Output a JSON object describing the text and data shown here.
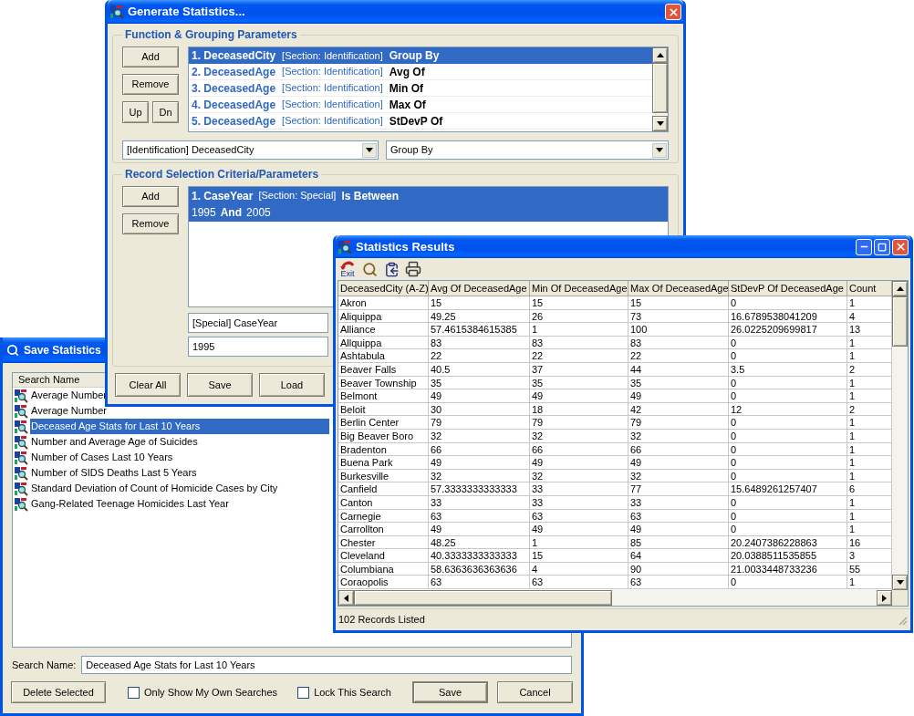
{
  "save_window": {
    "title": "Save Statistics",
    "column": "Search Name",
    "items": [
      {
        "name": "Average Number",
        "selected": false
      },
      {
        "name": "Average Number",
        "selected": false
      },
      {
        "name": "Deceased Age Stats for Last 10 Years",
        "selected": true
      },
      {
        "name": "Number and Average Age of Suicides",
        "selected": false
      },
      {
        "name": "Number of Cases Last 10 Years",
        "selected": false
      },
      {
        "name": "Number of SIDS Deaths Last 5 Years",
        "selected": false
      },
      {
        "name": "Standard Deviation of Count of Homicide Cases by City",
        "selected": false
      },
      {
        "name": "Gang-Related Teenage Homicides Last Year",
        "selected": false
      }
    ],
    "search_name_label": "Search Name:",
    "search_name_value": "Deceased Age Stats for Last 10 Years",
    "delete_button": "Delete Selected",
    "checkboxes": [
      {
        "label": "Only Show My Own Searches",
        "checked": false
      },
      {
        "label": "Lock This Search",
        "checked": false
      }
    ],
    "buttons": [
      "Save",
      "Cancel"
    ]
  },
  "generate_window": {
    "title": "Generate Statistics...",
    "function_group": {
      "title": "Function & Grouping Parameters",
      "buttons": [
        "Add",
        "Remove",
        "Up",
        "Dn"
      ],
      "items": [
        {
          "number": "1.",
          "field": "DeceasedCity",
          "section": "[Section: Identification]",
          "function": "Group By",
          "selected": true
        },
        {
          "number": "2.",
          "field": "DeceasedAge",
          "section": "[Section: Identification]",
          "function": "Avg Of",
          "selected": false
        },
        {
          "number": "3.",
          "field": "DeceasedAge",
          "section": "[Section: Identification]",
          "function": "Min Of",
          "selected": false
        },
        {
          "number": "4.",
          "field": "DeceasedAge",
          "section": "[Section: Identification]",
          "function": "Max Of",
          "selected": false
        },
        {
          "number": "5.",
          "field": "DeceasedAge",
          "section": "[Section: Identification]",
          "function": "StDevP Of",
          "selected": false
        }
      ],
      "field_dropdown": "[Identification] DeceasedCity",
      "function_dropdown": "Group By"
    },
    "criteria": {
      "title": "Record Selection Criteria/Parameters",
      "buttons": [
        "Add",
        "Remove"
      ],
      "items": [
        {
          "number": "1.",
          "field": "CaseYear",
          "section": "[Section: Special]",
          "operator": "Is Between",
          "value_from": "1995",
          "conjunction": "And",
          "value_to": "2005",
          "selected": true
        }
      ],
      "field_dropdown": "[Special] CaseYear",
      "value_field": "1995"
    },
    "buttons": [
      "Clear All",
      "Save",
      "Load"
    ]
  },
  "results_window": {
    "title": "Statistics Results",
    "toolbar": [
      {
        "kind": "exit",
        "label": "Exit"
      },
      {
        "kind": "search"
      },
      {
        "kind": "copy"
      },
      {
        "kind": "print"
      }
    ],
    "table": {
      "columns": [
        "DeceasedCity (A-Z)",
        "Avg Of DeceasedAge",
        "Min Of DeceasedAge",
        "Max Of DeceasedAge",
        "StDevP Of DeceasedAge",
        "Count"
      ],
      "rows": [
        [
          "Akron",
          "15",
          "15",
          "15",
          "0",
          "1"
        ],
        [
          "Aliquippa",
          "49.25",
          "26",
          "73",
          "16.6789538041209",
          "4"
        ],
        [
          "Alliance",
          "57.4615384615385",
          "1",
          "100",
          "26.0225209699817",
          "13"
        ],
        [
          "Allquippa",
          "83",
          "83",
          "83",
          "0",
          "1"
        ],
        [
          "Ashtabula",
          "22",
          "22",
          "22",
          "0",
          "1"
        ],
        [
          "Beaver Falls",
          "40.5",
          "37",
          "44",
          "3.5",
          "2"
        ],
        [
          "Beaver Township",
          "35",
          "35",
          "35",
          "0",
          "1"
        ],
        [
          "Belmont",
          "49",
          "49",
          "49",
          "0",
          "1"
        ],
        [
          "Beloit",
          "30",
          "18",
          "42",
          "12",
          "2"
        ],
        [
          "Berlin Center",
          "79",
          "79",
          "79",
          "0",
          "1"
        ],
        [
          "Big Beaver Boro",
          "32",
          "32",
          "32",
          "0",
          "1"
        ],
        [
          "Bradenton",
          "66",
          "66",
          "66",
          "0",
          "1"
        ],
        [
          "Buena Park",
          "49",
          "49",
          "49",
          "0",
          "1"
        ],
        [
          "Burkesville",
          "32",
          "32",
          "32",
          "0",
          "1"
        ],
        [
          "Canfield",
          "57.3333333333333",
          "33",
          "77",
          "15.6489261257407",
          "6"
        ],
        [
          "Canton",
          "33",
          "33",
          "33",
          "0",
          "1"
        ],
        [
          "Carnegie",
          "63",
          "63",
          "63",
          "0",
          "1"
        ],
        [
          "Carrollton",
          "49",
          "49",
          "49",
          "0",
          "1"
        ],
        [
          "Chester",
          "48.25",
          "1",
          "85",
          "20.2407386228863",
          "16"
        ],
        [
          "Cleveland",
          "40.3333333333333",
          "15",
          "64",
          "20.0388511535855",
          "3"
        ],
        [
          "Columbiana",
          "58.6363636363636",
          "4",
          "90",
          "21.0033448733236",
          "55"
        ],
        [
          "Coraopolis",
          "63",
          "63",
          "63",
          "0",
          "1"
        ]
      ]
    },
    "status_bar": "102 Records Listed"
  }
}
